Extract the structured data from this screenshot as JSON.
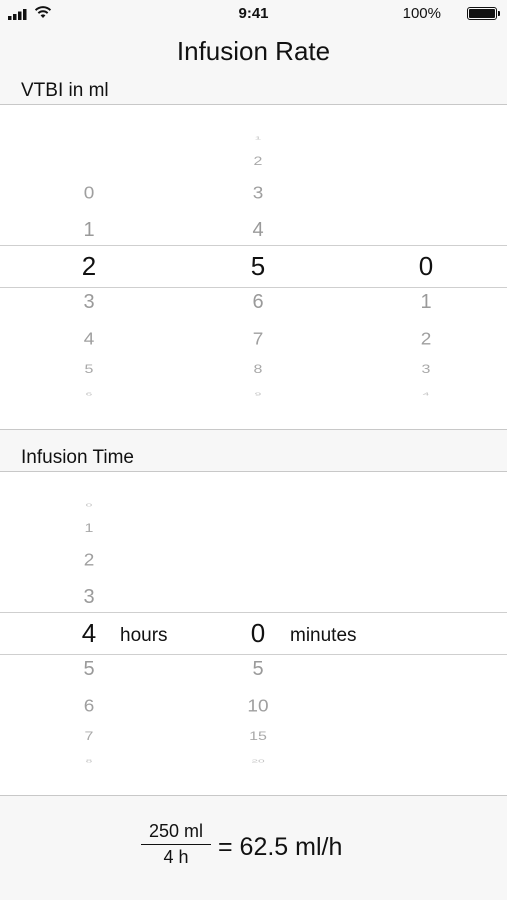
{
  "status_bar": {
    "time": "9:41",
    "battery_percent": "100%"
  },
  "header": {
    "title": "Infusion Rate"
  },
  "vtbi": {
    "label": "VTBI in ml",
    "wheels": [
      {
        "above": [
          "0",
          "1"
        ],
        "selected": "2",
        "below": [
          "3",
          "4",
          "5",
          "6"
        ]
      },
      {
        "above": [
          "1",
          "2",
          "3",
          "4"
        ],
        "selected": "5",
        "below": [
          "6",
          "7",
          "8",
          "9"
        ]
      },
      {
        "above": [],
        "selected": "0",
        "below": [
          "1",
          "2",
          "3",
          "4"
        ]
      }
    ]
  },
  "infusion_time": {
    "label": "Infusion Time",
    "hours_wheel": {
      "above": [
        "0",
        "1",
        "2",
        "3"
      ],
      "selected": "4",
      "below": [
        "5",
        "6",
        "7",
        "8"
      ]
    },
    "hours_unit": "hours",
    "minutes_wheel": {
      "above": [],
      "selected": "0",
      "below": [
        "5",
        "10",
        "15",
        "20"
      ]
    },
    "minutes_unit": "minutes"
  },
  "result": {
    "numerator": "250 ml",
    "denominator": "4 h",
    "value": "= 62.5 ml/h"
  }
}
